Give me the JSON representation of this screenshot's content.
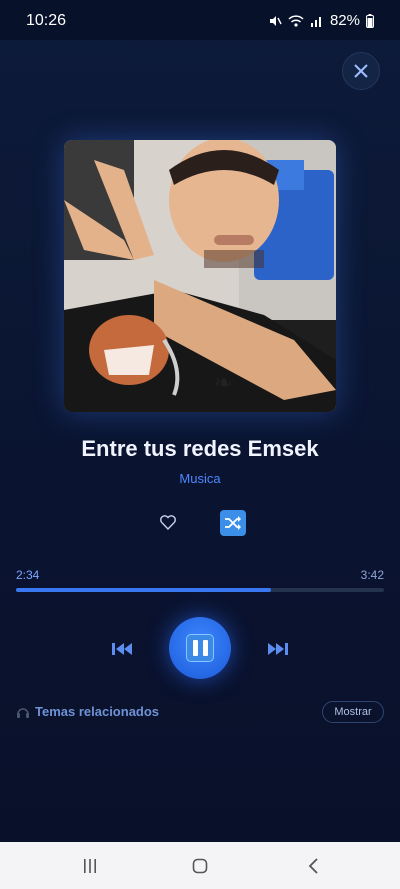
{
  "status_bar": {
    "time": "10:26",
    "battery": "82%"
  },
  "song": {
    "title": "Entre tus redes Emsek",
    "artist": "Musica"
  },
  "player": {
    "current_time": "2:34",
    "total_time": "3:42",
    "progress": 0.693
  },
  "related": {
    "label": "Temas relacionados",
    "button": "Mostrar"
  },
  "colors": {
    "accent": "#3a78f2",
    "background": "#0b1530",
    "artist_text": "#4d86ff"
  },
  "icons": {
    "close": "close-icon",
    "heart": "heart-icon",
    "shuffle": "shuffle-icon",
    "prev": "skip-previous-icon",
    "play_pause": "pause-icon",
    "next": "skip-next-icon",
    "related": "headphones-icon"
  }
}
